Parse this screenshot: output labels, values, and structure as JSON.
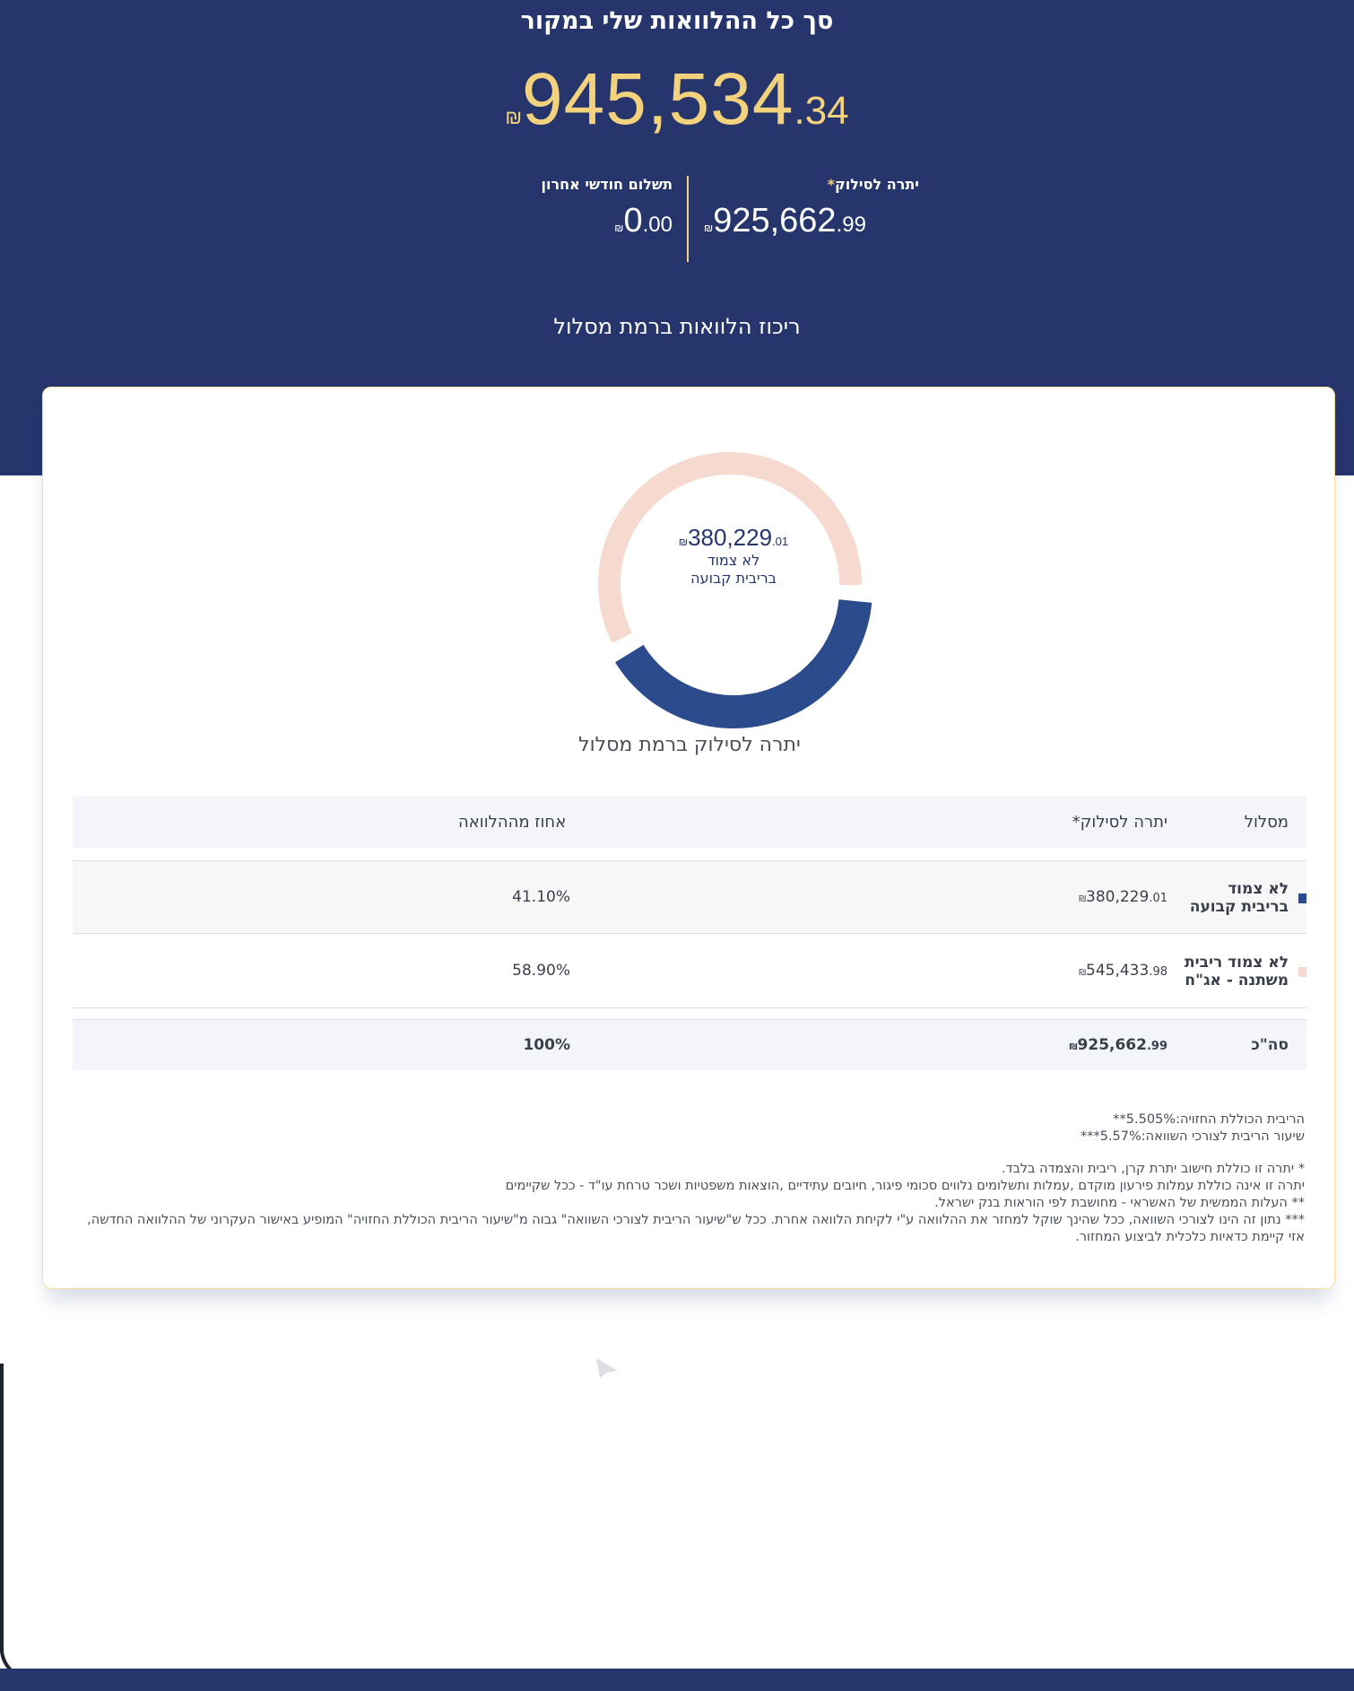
{
  "header": {
    "title": "סך כל ההלוואות שלי במקור",
    "total": {
      "currency": "₪",
      "main": "945,534",
      "decimal": ".34"
    },
    "left_stat": {
      "label": "תשלום חודשי אחרון",
      "currency": "₪",
      "main": "0",
      "decimal": ".00"
    },
    "right_stat": {
      "label": "יתרה לסילוק",
      "star": "*",
      "currency": "₪",
      "main": "925,662",
      "decimal": ".99"
    },
    "section_title": "ריכוז הלוואות ברמת מסלול"
  },
  "chart_data": {
    "type": "pie",
    "donut": true,
    "slices": [
      {
        "label": "לא צמוד בריבית קבועה",
        "value": 380229.01,
        "percent": 41.1,
        "color": "#2b4b8c"
      },
      {
        "label": "לא צמוד ריבית משתנה - אג\"ח",
        "value": 545433.98,
        "percent": 58.9,
        "color": "#f6d9cf"
      }
    ],
    "center": {
      "currency": "₪",
      "main": "380,229",
      "decimal": ".01",
      "line1": "לא צמוד",
      "line2": "בריבית קבועה"
    },
    "caption": "יתרה לסילוק ברמת מסלול"
  },
  "table": {
    "headers": {
      "track": "מסלול",
      "balance": "יתרה לסילוק*",
      "percent": "אחוז מההלוואה"
    },
    "rows": [
      {
        "name_line1": "לא צמוד",
        "name_line2": "בריבית קבועה",
        "color": "#2b4b8c",
        "currency": "₪",
        "main": "380,229",
        "decimal": ".01",
        "percent": "41.10%"
      },
      {
        "name_line1": "לא צמוד ריבית",
        "name_line2": "משתנה - אג\"ח",
        "color": "#f6d9cf",
        "currency": "₪",
        "main": "545,433",
        "decimal": ".98",
        "percent": "58.90%"
      }
    ],
    "total": {
      "label": "סה\"כ",
      "currency": "₪",
      "main": "925,662",
      "decimal": ".99",
      "percent": "100%"
    }
  },
  "notes": {
    "rate1": "הריבית הכוללת החזויה:5.505%**",
    "rate2": "שיעור הריבית לצורכי השוואה:5.57%***",
    "f1": "* יתרה זו כוללת חישוב יתרת קרן, ריבית והצמדה בלבד.",
    "f2": "יתרה זו אינה כוללת עמלות פירעון מוקדם ,עמלות ותשלומים נלווים סכומי פיגור, חיובים עתידיים ,הוצאות משפטיות ושכר טרחת עו\"ד - ככל שקיימים",
    "f3": "** העלות הממשית של האשראי - מחושבת לפי הוראות בנק ישראל.",
    "f4": "*** נתון זה הינו לצורכי השוואה, ככל שהינך שוקל למחזר את ההלוואה ע\"י לקיחת הלוואה אחרת. ככל ש\"שיעור הריבית לצורכי השוואה\" גבוה מ\"שיעור הריבית הכוללת החזויה\" המופיע באישור העקרוני של ההלוואה החדשה, אזי קיימת כדאיות כלכלית לביצוע המחזור."
  }
}
